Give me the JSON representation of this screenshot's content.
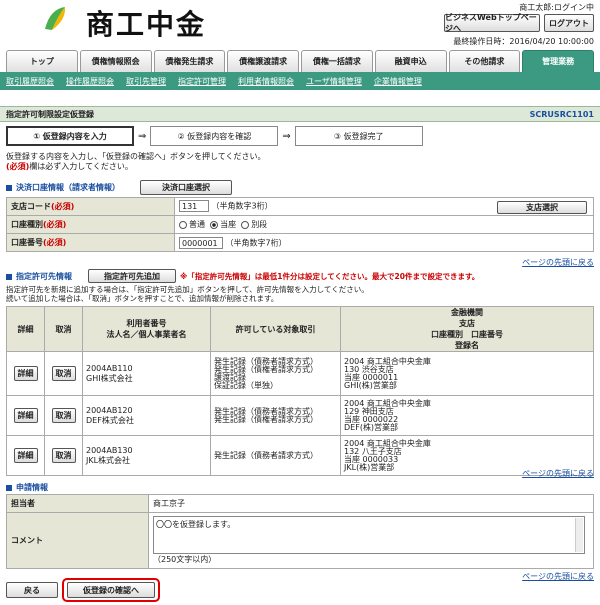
{
  "header": {
    "logo_text": "商工中金",
    "user_name": "商工太郎:ログイン中",
    "business_top_label": "ビジネスWebトップページへ",
    "logout_label": "ログアウト",
    "last_operation": "最終操作日時：2016/04/20 10:00:00"
  },
  "tabs": [
    "トップ",
    "債権情報照会",
    "債権発生請求",
    "債権譲渡請求",
    "債権一括請求",
    "融資申込",
    "その他請求",
    "管理業務"
  ],
  "active_tab_index": 7,
  "subnav": [
    "取引履歴照会",
    "操作履歴照会",
    "取引先管理",
    "指定許可管理",
    "利用者情報照会",
    "ユーザ情報管理",
    "企業情報管理"
  ],
  "page": {
    "title": "指定許可制限設定仮登録",
    "code": "SCRUSRC1101"
  },
  "steps": [
    "① 仮登録内容を入力",
    "② 仮登録内容を確認",
    "③ 仮登録完了"
  ],
  "intro": {
    "line1": "仮登録する内容を入力し、「仮登録の確認へ」ボタンを押してください。",
    "req": "(必須)",
    "line2": "欄は必ず入力してください。"
  },
  "account": {
    "title": "決済口座情報（請求者情報）",
    "select_button": "決済口座選択",
    "branch_label": "支店コード",
    "required": "(必須)",
    "branch_value": "131",
    "branch_hint": "（半角数字3桁）",
    "branch_select_button": "支店選択",
    "type_label": "口座種別",
    "type_options": [
      "普通",
      "当座",
      "別段"
    ],
    "type_selected": 1,
    "number_label": "口座番号",
    "number_value": "0000001",
    "number_hint": "（半角数字7桁）"
  },
  "top_link": "ページの先頭に戻る",
  "permits": {
    "title": "指定許可先情報",
    "add_button": "指定許可先追加",
    "warning": "※「指定許可先情報」は最低1件分は設定してください。最大で20件まで設定できます。",
    "note1": "指定許可先を新規に追加する場合は、「指定許可先追加」ボタンを押して、許可先情報を入力してください。",
    "note2": "続いて追加した場合は、「取消」ボタンを押すことで、追加情報が削除されます。",
    "headers": {
      "detail": "詳細",
      "cancel": "取消",
      "user": "利用者番号\n法人名／個人事業者名",
      "scope": "許可している対象取引",
      "bank": "金融機関\n支店\n口座種別　口座番号\n登録名"
    },
    "detail_button": "詳細",
    "cancel_button": "取消",
    "rows": [
      {
        "user": "2004AB110\nGHI株式会社",
        "scope": "発生記録（債務者請求方式）\n発生記録（債権者請求方式）\n譲渡記録\n保証記録（単独）",
        "bank": "2004 商工組合中央金庫\n130 渋谷支店\n当座 0000011\nGHI(株)営業部"
      },
      {
        "user": "2004AB120\nDEF株式会社",
        "scope": "発生記録（債務者請求方式）\n発生記録（債権者請求方式）",
        "bank": "2004 商工組合中央金庫\n129 神田支店\n当座 0000022\nDEF(株)営業部"
      },
      {
        "user": "2004AB130\nJKL株式会社",
        "scope": "発生記録（債務者請求方式）",
        "bank": "2004 商工組合中央金庫\n132 八王子支店\n当座 0000033\nJKL(株)営業部"
      }
    ]
  },
  "apply": {
    "title": "申請情報",
    "person_label": "担当者",
    "person_value": "商工京子",
    "comment_label": "コメント",
    "comment_value": "〇〇を仮登録します。",
    "comment_hint": "（250文字以内）"
  },
  "footer": {
    "back_button": "戻る",
    "confirm_button": "仮登録の確認へ"
  },
  "colors": {
    "accent": "#3c9a82",
    "link": "#1a4fa0",
    "required": "#cc0000",
    "highlight": "#e00000"
  }
}
